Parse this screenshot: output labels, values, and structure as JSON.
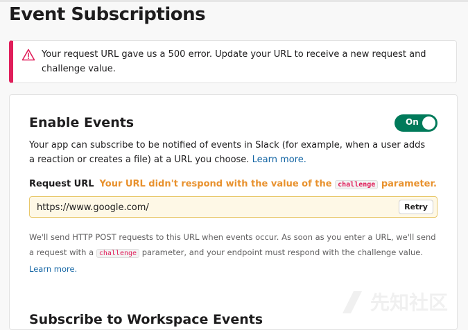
{
  "page": {
    "title": "Event Subscriptions"
  },
  "alert": {
    "icon": "warning-triangle-icon",
    "message": "Your request URL gave us a 500 error. Update your URL to receive a new request and challenge value.",
    "color": "#e01e5a"
  },
  "enable_events": {
    "title": "Enable Events",
    "toggle_label": "On",
    "toggle_state": "on",
    "description": "Your app can subscribe to be notified of events in Slack (for example, when a user adds a reaction or creates a file) at a URL you choose.",
    "learn_more": "Learn more."
  },
  "request_url": {
    "label": "Request URL",
    "error_before": "Your URL didn't respond with the value of the",
    "error_code": "challenge",
    "error_after": "parameter.",
    "value": "https://www.google.com/",
    "retry_label": "Retry"
  },
  "help": {
    "text_before": "We'll send HTTP POST requests to this URL when events occur. As soon as you enter a URL, we'll send a request with a",
    "code": "challenge",
    "text_after": "parameter, and your endpoint must respond with the challenge value.",
    "learn_more": "Learn more."
  },
  "section": {
    "title": "Subscribe to Workspace Events"
  },
  "watermark": {
    "text": "先知社区"
  },
  "colors": {
    "accent_green": "#007a5a",
    "link": "#1264a3",
    "error_orange": "#e8912d",
    "alert_red": "#e01e5a"
  }
}
